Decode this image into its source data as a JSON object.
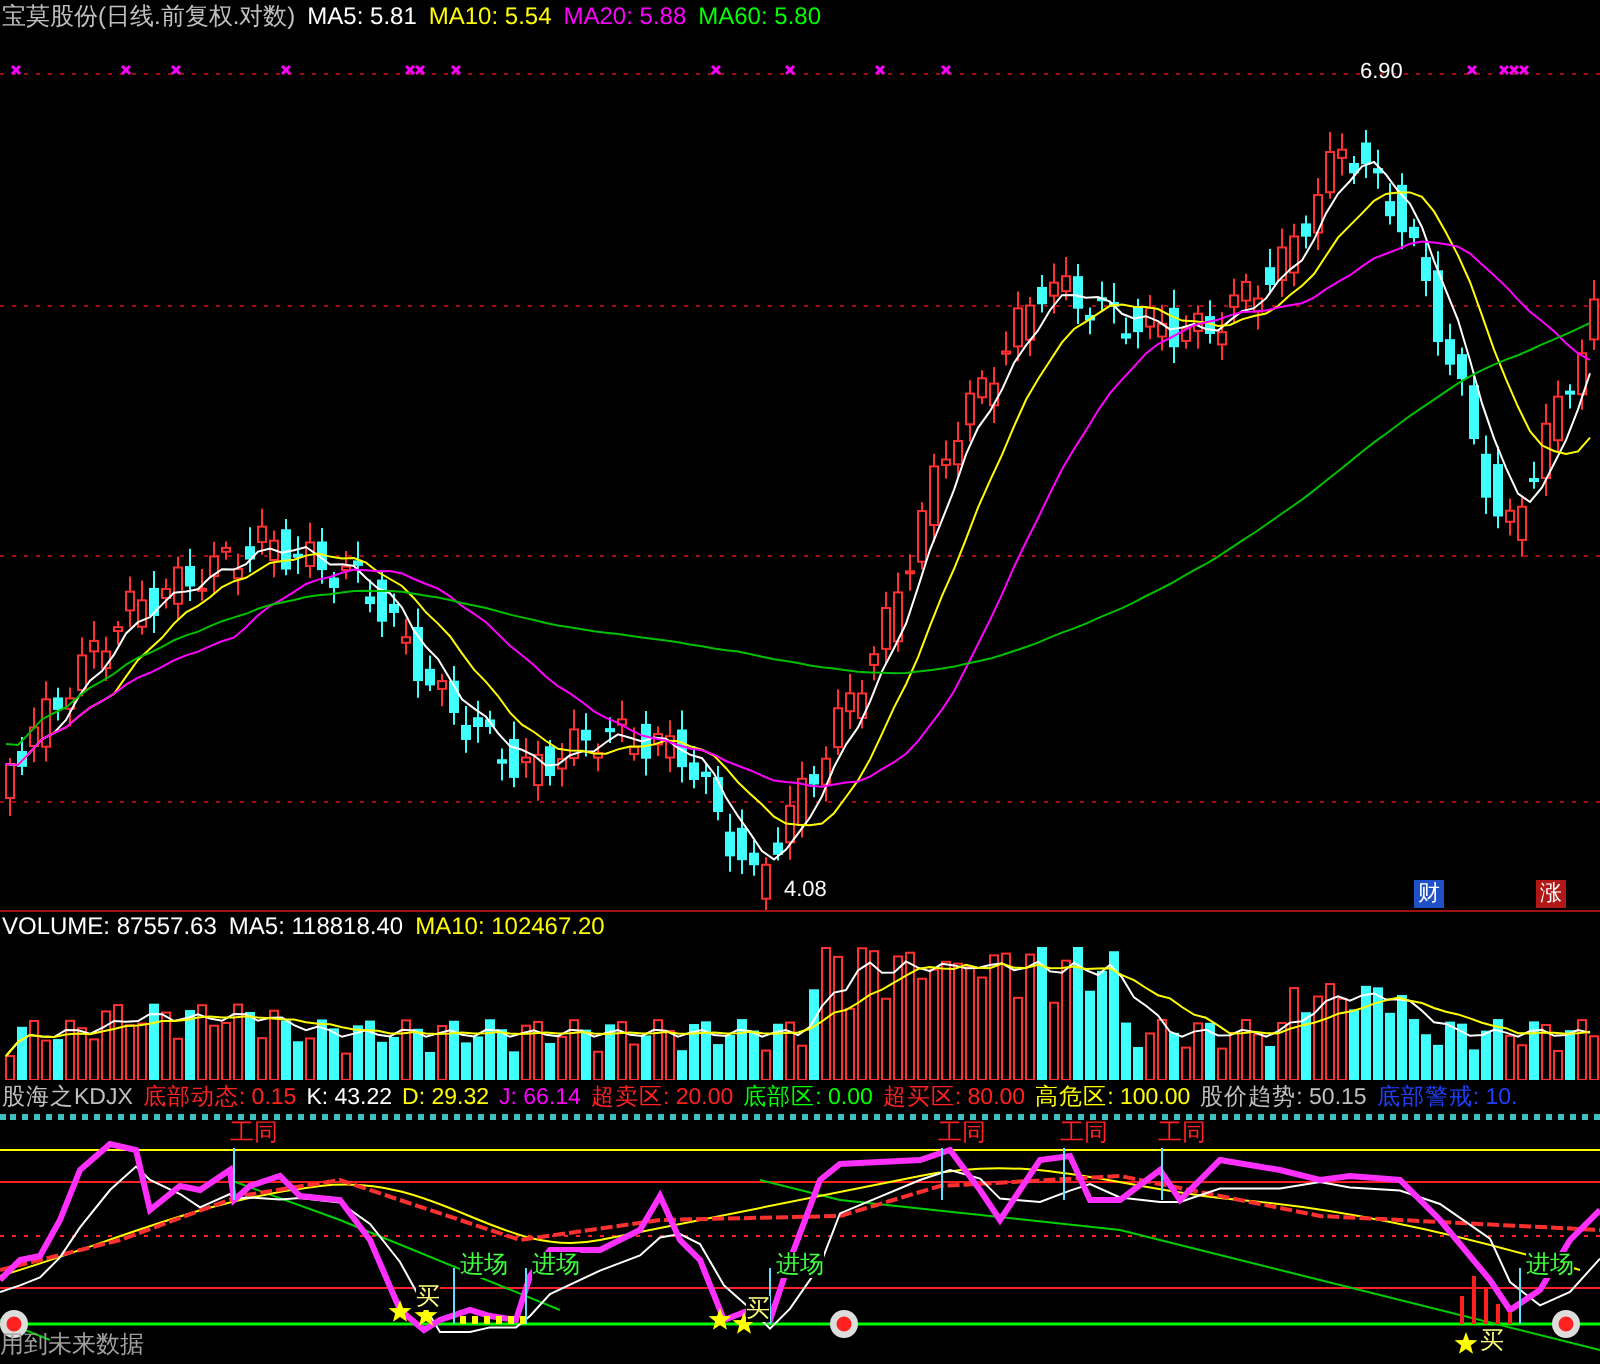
{
  "header": {
    "title": "宝莫股份(日线.前复权.对数)",
    "readings": [
      {
        "label": "MA5: 5.81",
        "color": "#ffffff"
      },
      {
        "label": "MA10: 5.54",
        "color": "#ffff00"
      },
      {
        "label": "MA20: 5.88",
        "color": "#ff00ff"
      },
      {
        "label": "MA60: 5.80",
        "color": "#00ff00"
      }
    ]
  },
  "price_chart": {
    "high_label": "6.90",
    "low_label": "4.08",
    "badges": [
      {
        "text": "财",
        "color": "#1e50c8"
      },
      {
        "text": "涨",
        "color": "#b01818"
      }
    ]
  },
  "volume": {
    "readings": [
      {
        "label": "VOLUME: 87557.63",
        "color": "#ffffff"
      },
      {
        "label": "MA5: 118818.40",
        "color": "#ffffff"
      },
      {
        "label": "MA10: 102467.20",
        "color": "#ffff00"
      }
    ]
  },
  "indicator": {
    "readings": [
      {
        "label": "股海之KDJX",
        "color": "#c0c0c0"
      },
      {
        "label": "底部动态: 0.15",
        "color": "#ff2020"
      },
      {
        "label": "K: 43.22",
        "color": "#ffffff"
      },
      {
        "label": "D: 29.32",
        "color": "#ffff00"
      },
      {
        "label": "J: 66.14",
        "color": "#ff00ff"
      },
      {
        "label": "超卖区: 20.00",
        "color": "#ff2020"
      },
      {
        "label": "底部区: 0.00",
        "color": "#00ff00"
      },
      {
        "label": "超买区: 80.00",
        "color": "#ff2020"
      },
      {
        "label": "高危区: 100.00",
        "color": "#ffff00"
      },
      {
        "label": "股价趋势: 50.15",
        "color": "#c0c0c0"
      },
      {
        "label": "底部警戒: 10.",
        "color": "#2040ff"
      }
    ],
    "exit_labels": [
      "工同",
      "工同",
      "工同",
      "工同"
    ],
    "entry_labels": [
      "进场",
      "进场",
      "进场",
      "进场"
    ],
    "buy_labels": [
      "买",
      "买",
      "买"
    ],
    "note": "用到未来数据"
  }
}
